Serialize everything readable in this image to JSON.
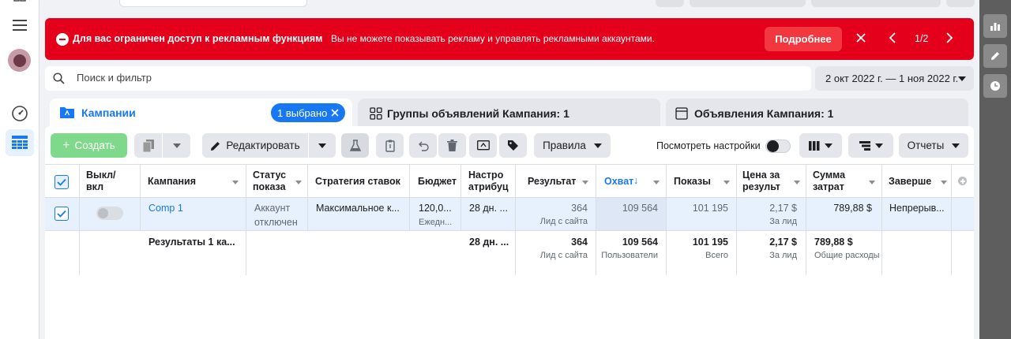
{
  "alert": {
    "title": "Для вас ограничен доступ к рекламным функциям",
    "message": "Вы не можете показывать рекламу и управлять рекламными аккаунтами.",
    "more_label": "Подробнее",
    "pager": "1/2"
  },
  "search": {
    "placeholder": "Поиск и фильтр"
  },
  "date_range": "2 окт 2022 г. — 1 ноя 2022 г.",
  "tabs": {
    "campaigns": "Кампании",
    "selected_badge": "1 выбрано",
    "adsets": "Группы объявлений Кампания: 1",
    "ads": "Объявления Кампания: 1"
  },
  "toolbar": {
    "create": "Создать",
    "edit": "Редактировать",
    "rules": "Правила",
    "view_settings": "Посмотреть настройки",
    "reports": "Отчеты"
  },
  "columns": {
    "toggle": "Выкл/ вкл",
    "campaign": "Кампания",
    "status": "Статус показа",
    "bid": "Стратегия ставок",
    "budget": "Бюджет",
    "attribution": "Настро атрибуц",
    "result": "Результат",
    "reach": "Охват",
    "impressions": "Показы",
    "cost": "Цена за результ",
    "spend": "Сумма затрат",
    "end": "Заверше"
  },
  "row": {
    "campaign": "Comp 1",
    "status": "Аккаунт отключен",
    "bid": "Максимальное к...",
    "budget": "120,0...",
    "budget_sub": "Ежедн...",
    "attribution": "28 дн. ...",
    "result": "364",
    "result_sub": "Лид с сайта",
    "reach": "109 564",
    "impressions": "101 195",
    "cost": "2,17 $",
    "cost_sub": "За лид",
    "spend": "789,88 $",
    "end": "Непрерыв..."
  },
  "summary": {
    "label": "Результаты 1 ка...",
    "attribution": "28 дн. ...",
    "result": "364",
    "result_sub": "Лид с сайта",
    "reach": "109 564",
    "reach_sub": "Пользователи",
    "impressions": "101 195",
    "impressions_sub": "Всего",
    "cost": "2,17 $",
    "cost_sub": "За лид",
    "spend": "789,88 $",
    "spend_sub": "Общие расходы"
  },
  "colors": {
    "accent": "#1877f2",
    "alert": "#e4001a",
    "create": "#7fd98a"
  }
}
